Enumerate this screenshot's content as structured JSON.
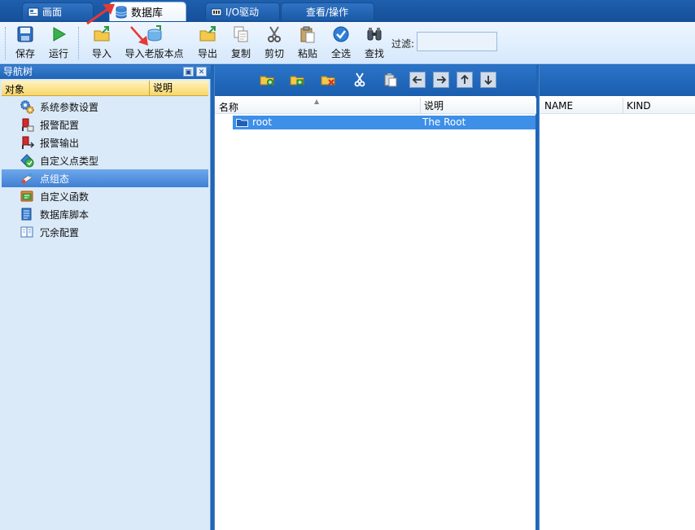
{
  "tabs": [
    {
      "label": "画面",
      "active": false
    },
    {
      "label": "数据库",
      "active": true
    },
    {
      "label": "I/O驱动",
      "active": false
    },
    {
      "label": "查看/操作",
      "active": false
    }
  ],
  "toolbar": {
    "save": "保存",
    "run": "运行",
    "import": "导入",
    "import_old": "导入老版本点",
    "export": "导出",
    "copy": "复制",
    "cut": "剪切",
    "paste": "粘贴",
    "select_all": "全选",
    "find": "查找",
    "filter_label": "过滤:",
    "filter_value": ""
  },
  "nav": {
    "title": "导航树",
    "col_object": "对象",
    "col_desc": "说明",
    "items": [
      {
        "label": "系统参数设置",
        "icon": "gears-icon"
      },
      {
        "label": "报警配置",
        "icon": "alarm-config-icon"
      },
      {
        "label": "报警输出",
        "icon": "alarm-output-icon"
      },
      {
        "label": "自定义点类型",
        "icon": "custom-point-type-icon"
      },
      {
        "label": "点组态",
        "icon": "point-config-icon",
        "selected": true
      },
      {
        "label": "自定义函数",
        "icon": "custom-function-icon"
      },
      {
        "label": "数据库脚本",
        "icon": "database-script-icon"
      },
      {
        "label": "冗余配置",
        "icon": "redundancy-icon"
      }
    ]
  },
  "center": {
    "col_name": "名称",
    "col_desc": "说明",
    "rows": [
      {
        "name": "root",
        "desc": "The Root"
      }
    ]
  },
  "right": {
    "col_name": "NAME",
    "col_kind": "KIND"
  },
  "colors": {
    "frame_blue": "#1f66b8",
    "selection_blue": "#3d8fe8",
    "nav_bg": "#dbeaf8",
    "header_yellow": "#f8d76a",
    "annotation_red": "#e53935"
  }
}
